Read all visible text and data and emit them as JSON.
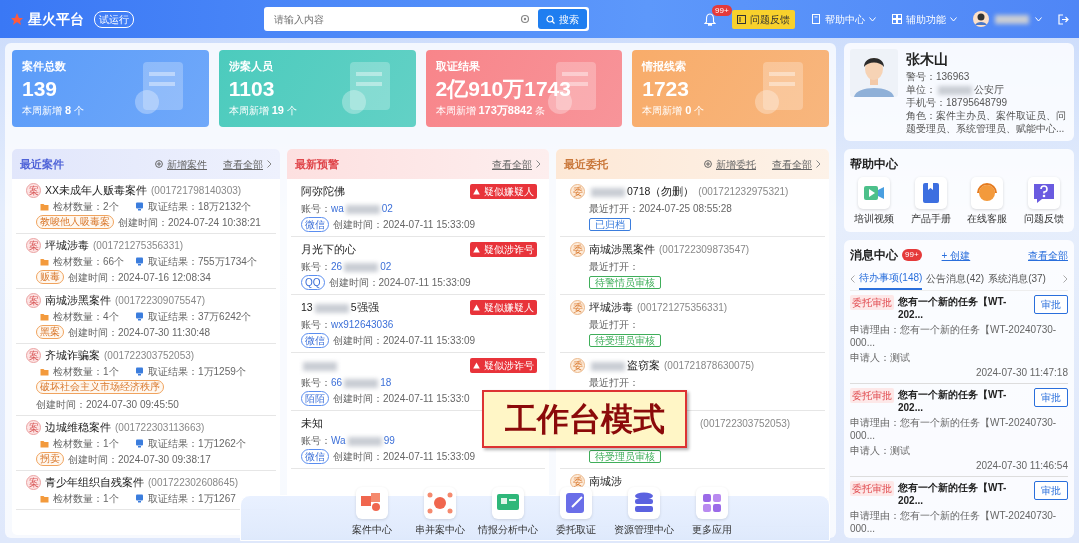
{
  "header": {
    "brand": "星火平台",
    "brand_badge": "试运行",
    "search": {
      "placeholder": "请输入内容",
      "button": "搜索"
    },
    "notification_badge": "99+",
    "feedback_button": "问题反馈",
    "help_menu": "帮助中心",
    "assist_menu": "辅助功能"
  },
  "stats": [
    {
      "label": "案件总数",
      "value": "139",
      "weekly_label": "本周新增",
      "weekly_value": "8",
      "unit": "个",
      "color": "#5b9cf9"
    },
    {
      "label": "涉案人员",
      "value": "1103",
      "weekly_label": "本周新增",
      "weekly_value": "19",
      "unit": "个",
      "color": "#4ccbbd"
    },
    {
      "label": "取证结果",
      "value": "2亿910万1743",
      "weekly_label": "本周新增",
      "weekly_value": "173万8842",
      "unit": "条",
      "color": "#f8858a"
    },
    {
      "label": "情报线索",
      "value": "1723",
      "weekly_label": "本周新增",
      "weekly_value": "0",
      "unit": "个",
      "color": "#f8ac6a"
    }
  ],
  "recent_cases": {
    "title": "最近案件",
    "add_link": "新增案件",
    "view_all": "查看全部",
    "items": [
      {
        "mark": "案",
        "title": "XX未成年人贩毒案件",
        "code": "(001721798140303)",
        "count": "检材数量：2个",
        "result": "取证结果：18万2132个",
        "tag": "教唆他人吸毒案",
        "created": "创建时间：2024-07-24 10:38:21"
      },
      {
        "mark": "案",
        "title": "坪城涉毒",
        "code": "(001721275356331)",
        "count": "检材数量：66个",
        "result": "取证结果：755万1734个",
        "tag": "贩毒",
        "created": "创建时间：2024-07-16 12:08:34"
      },
      {
        "mark": "案",
        "title": "南城涉黑案件",
        "code": "(001722309075547)",
        "count": "检材数量：4个",
        "result": "取证结果：37万6242个",
        "tag": "黑案",
        "created": "创建时间：2024-07-30 11:30:48"
      },
      {
        "mark": "案",
        "title": "齐城诈骗案",
        "code": "(001722303752053)",
        "count": "检材数量：1个",
        "result": "取证结果：1万1259个",
        "tag": "破坏社会主义市场经济秩序",
        "created": "创建时间：2024-07-30 09:45:50"
      },
      {
        "mark": "案",
        "title": "边城维稳案件",
        "code": "(001722303113663)",
        "count": "检材数量：1个",
        "result": "取证结果：1万1262个",
        "tag": "拐卖",
        "created": "创建时间：2024-07-30 09:38:17"
      },
      {
        "mark": "案",
        "title": "青少年组织自残案件",
        "code": "(001722302608645)",
        "count": "检材数量：1个",
        "result": "取证结果：1万1267"
      }
    ]
  },
  "warnings": {
    "title": "最新预警",
    "view_all": "查看全部",
    "items": [
      {
        "name": [
          {
            "kind": "text",
            "text": "阿弥陀佛"
          }
        ],
        "alert": "疑似嫌疑人",
        "account_label": "账号：",
        "account": [
          {
            "kind": "text",
            "text": "wa"
          },
          {
            "kind": "blur"
          },
          {
            "kind": "text",
            "text": "02"
          }
        ],
        "platform": "微信",
        "created": "创建时间：2024-07-11 15:33:09"
      },
      {
        "name": [
          {
            "kind": "text",
            "text": "月光下的心"
          }
        ],
        "alert": "疑似涉诈号",
        "account_label": "账号：",
        "account": [
          {
            "kind": "text",
            "text": "26"
          },
          {
            "kind": "blur"
          },
          {
            "kind": "text",
            "text": "02"
          }
        ],
        "platform": "QQ",
        "created": "创建时间：2024-07-11 15:33:09"
      },
      {
        "name": [
          {
            "kind": "text",
            "text": "13"
          },
          {
            "kind": "blur"
          },
          {
            "kind": "text",
            "text": "5强强"
          }
        ],
        "alert": "疑似嫌疑人",
        "account_label": "账号：",
        "account": [
          {
            "kind": "text",
            "text": "wx912643036"
          }
        ],
        "platform": "微信",
        "created": "创建时间：2024-07-11 15:33:09"
      },
      {
        "name": [
          {
            "kind": "blur"
          }
        ],
        "alert": "疑似涉诈号",
        "account_label": "账号：",
        "account": [
          {
            "kind": "text",
            "text": "66"
          },
          {
            "kind": "blur"
          },
          {
            "kind": "text",
            "text": "18"
          }
        ],
        "platform": "陌陌",
        "created": "创建时间：2024-07-11 15:33:0"
      },
      {
        "name": [
          {
            "kind": "text",
            "text": "未知"
          }
        ],
        "account_label": "账号：",
        "account": [
          {
            "kind": "text",
            "text": "Wa"
          },
          {
            "kind": "blur"
          },
          {
            "kind": "text",
            "text": "99"
          }
        ],
        "platform": "微信",
        "created": "创建时间：2024-07-11 15:33:09"
      }
    ]
  },
  "delegations": {
    "title": "最近委托",
    "add_link": "新增委托",
    "view_all": "查看全部",
    "items": [
      {
        "mark": "委",
        "title": [
          {
            "kind": "blur"
          },
          {
            "kind": "text",
            "text": "0718（勿删）"
          }
        ],
        "code": "(001721232975321)",
        "opened": "最近打开：2024-07-25 08:55:28",
        "status": "已归档",
        "color": "#3b7ddd"
      },
      {
        "mark": "委",
        "title": [
          {
            "kind": "text",
            "text": "南城涉黑案件"
          }
        ],
        "code": "(001722309873547)",
        "opened": "最近打开：",
        "status": "待警情员审核",
        "color": "#3fae5a"
      },
      {
        "mark": "委",
        "title": [
          {
            "kind": "text",
            "text": "坪城涉毒"
          }
        ],
        "code": "(001721275356331)",
        "opened": "最近打开：",
        "status": "待受理员审核",
        "color": "#3fae5a"
      },
      {
        "mark": "委",
        "title": [
          {
            "kind": "blur"
          },
          {
            "kind": "text",
            "text": "盗窃案"
          }
        ],
        "code": "(001721878630075)",
        "opened": "最近打开："
      },
      {
        "code": "(001722303752053)",
        "status": "待受理员审核",
        "color": "#3fae5a"
      },
      {
        "mark": "委",
        "title": [
          {
            "kind": "text",
            "text": "南城涉"
          }
        ]
      }
    ]
  },
  "dock": [
    {
      "label": "案件中心"
    },
    {
      "label": "串并案中心"
    },
    {
      "label": "情报分析中心"
    },
    {
      "label": "委托取证"
    },
    {
      "label": "资源管理中心"
    },
    {
      "label": "更多应用"
    }
  ],
  "mode_banner": "工作台模式",
  "profile": {
    "name": "张木山",
    "lines": [
      [
        {
          "kind": "text",
          "text": "警号：136963"
        }
      ],
      [
        {
          "kind": "text",
          "text": "单位："
        },
        {
          "kind": "blur"
        },
        {
          "kind": "text",
          "text": "公安厅"
        }
      ],
      [
        {
          "kind": "text",
          "text": "手机号：18795648799"
        }
      ],
      [
        {
          "kind": "text",
          "text": "角色：案件主办员、案件取证员、问题受理员、系统管理员、赋能中心..."
        }
      ]
    ]
  },
  "help_center": {
    "title": "帮助中心",
    "items": [
      {
        "label": "培训视频"
      },
      {
        "label": "产品手册"
      },
      {
        "label": "在线客服"
      },
      {
        "label": "问题反馈"
      }
    ]
  },
  "messages": {
    "title": "消息中心",
    "badge": "99+",
    "create": "+ 创建",
    "view_all": "查看全部",
    "tabs": [
      {
        "label": "待办事项(148)",
        "selected": true
      },
      {
        "label": "公告消息(42)",
        "selected": false
      },
      {
        "label": "系统消息(37)",
        "selected": false
      }
    ],
    "items": [
      {
        "tag": "委托审批",
        "title": "您有一个新的任务【WT-202...",
        "button": "审批",
        "reason": "申请理由：您有一个新的任务【WT-20240730-000...",
        "applicant": "申请人：测试",
        "time": "2024-07-30 11:47:18"
      },
      {
        "tag": "委托审批",
        "title": "您有一个新的任务【WT-202...",
        "button": "审批",
        "reason": "申请理由：您有一个新的任务【WT-20240730-000...",
        "applicant": "申请人：测试",
        "time": "2024-07-30 11:46:54"
      },
      {
        "tag": "委托审批",
        "title": "您有一个新的任务【WT-202...",
        "button": "审批",
        "reason": "申请理由：您有一个新的任务【WT-20240730-000..."
      }
    ]
  }
}
